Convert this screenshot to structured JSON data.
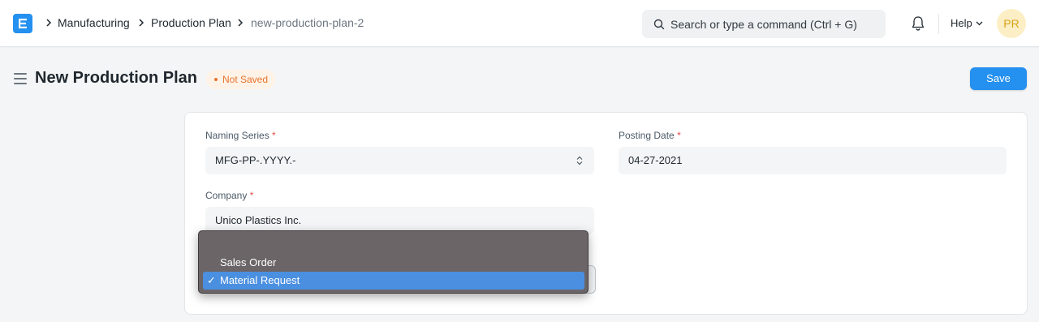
{
  "navbar": {
    "breadcrumbs": [
      "Manufacturing",
      "Production Plan",
      "new-production-plan-2"
    ],
    "search_placeholder": "Search or type a command (Ctrl + G)",
    "help_label": "Help",
    "avatar_initials": "PR"
  },
  "page": {
    "title": "New Production Plan",
    "status": "Not Saved",
    "save_label": "Save"
  },
  "form": {
    "naming_series": {
      "label": "Naming Series",
      "required": "*",
      "value": "MFG-PP-.YYYY.-"
    },
    "posting_date": {
      "label": "Posting Date",
      "required": "*",
      "value": "04-27-2021"
    },
    "company": {
      "label": "Company",
      "required": "*",
      "value": "Unico Plastics Inc."
    }
  },
  "dropdown": {
    "options": [
      "",
      "Sales Order",
      "Material Request"
    ],
    "selected": "Material Request",
    "check": "✓"
  },
  "colors": {
    "primary": "#2490ef",
    "status": "#e8742c",
    "required": "#e24c4c",
    "dropdown_bg": "#6b6568",
    "dropdown_highlight": "#4a8fe0"
  }
}
